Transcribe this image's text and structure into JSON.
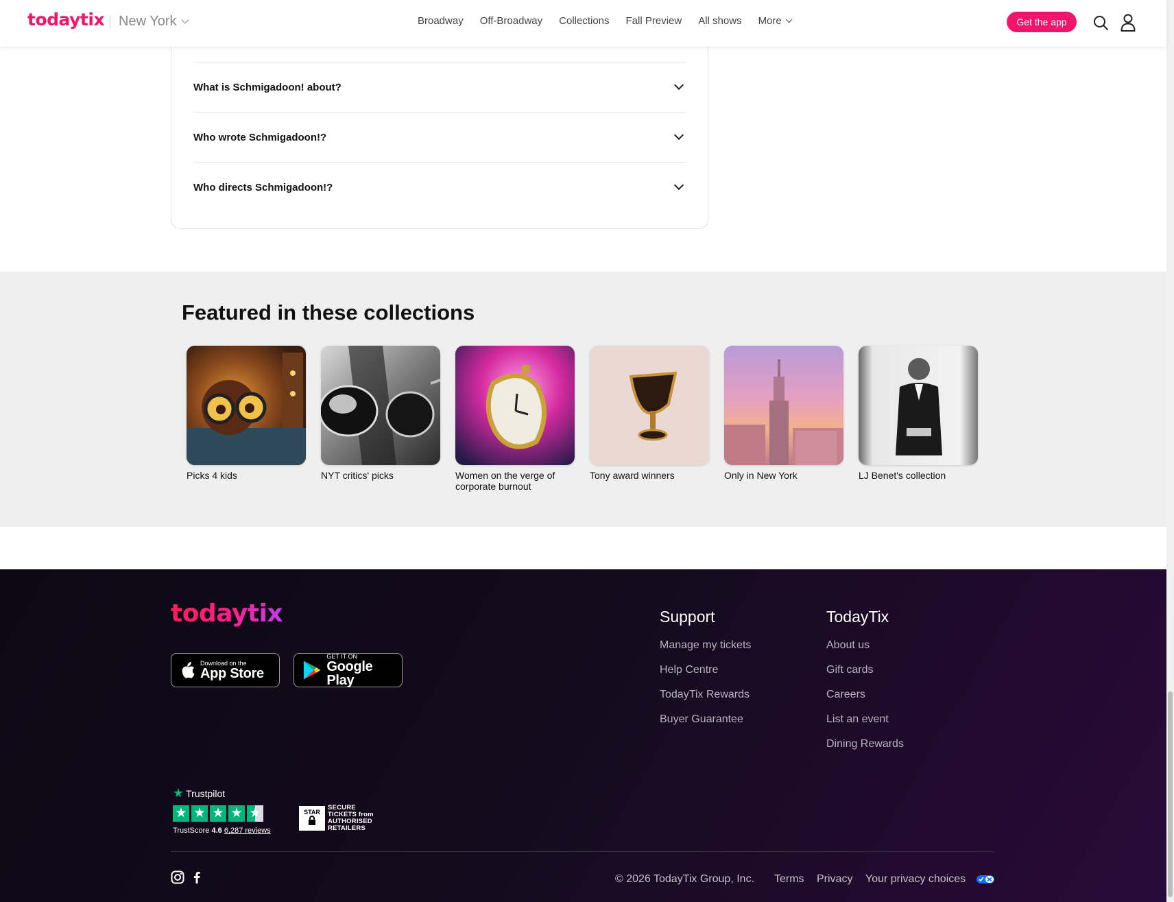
{
  "header": {
    "logo": "todaytix",
    "city": "New York",
    "nav": [
      "Broadway",
      "Off-Broadway",
      "Collections",
      "Fall Preview",
      "All shows",
      "More"
    ],
    "cta": "Get the app"
  },
  "faq": {
    "items": [
      "What is Schmigadoon! about?",
      "Who wrote Schmigadoon!?",
      "Who directs Schmigadoon!?"
    ]
  },
  "collections": {
    "title": "Featured in these collections",
    "items": [
      {
        "label": "Picks 4 kids"
      },
      {
        "label": "NYT critics' picks"
      },
      {
        "label": "Women on the verge of corporate burnout"
      },
      {
        "label": "Tony award winners"
      },
      {
        "label": "Only in New York"
      },
      {
        "label": "LJ Benet's collection"
      }
    ]
  },
  "footer": {
    "logo": "todaytix",
    "app_store": {
      "small": "Download on the",
      "big": "App Store"
    },
    "google_play": {
      "small": "GET IT ON",
      "big": "Google Play"
    },
    "support": {
      "title": "Support",
      "links": [
        "Manage my tickets",
        "Help Centre",
        "TodayTix Rewards",
        "Buyer Guarantee"
      ]
    },
    "todaytix": {
      "title": "TodayTix",
      "links": [
        "About us",
        "Gift cards",
        "Careers",
        "List an event",
        "Dining Rewards"
      ]
    },
    "trustpilot": {
      "brand": "Trustpilot",
      "score_label": "TrustScore",
      "score": "4.6",
      "reviews": "6,287 reviews",
      "rating": 4.5
    },
    "star_badge": {
      "logo": "STAR",
      "line1": "SECURE",
      "line2": "TICKETS from",
      "line3": "AUTHORISED",
      "line4": "RETAILERS"
    },
    "copyright": "© 2026 TodayTix Group, Inc.",
    "terms": "Terms",
    "privacy": "Privacy",
    "privacy_choices": "Your privacy choices"
  },
  "colors": {
    "brand": "#f0166d",
    "footer_bg": "#120c1a",
    "trustpilot_green": "#00b67a"
  }
}
